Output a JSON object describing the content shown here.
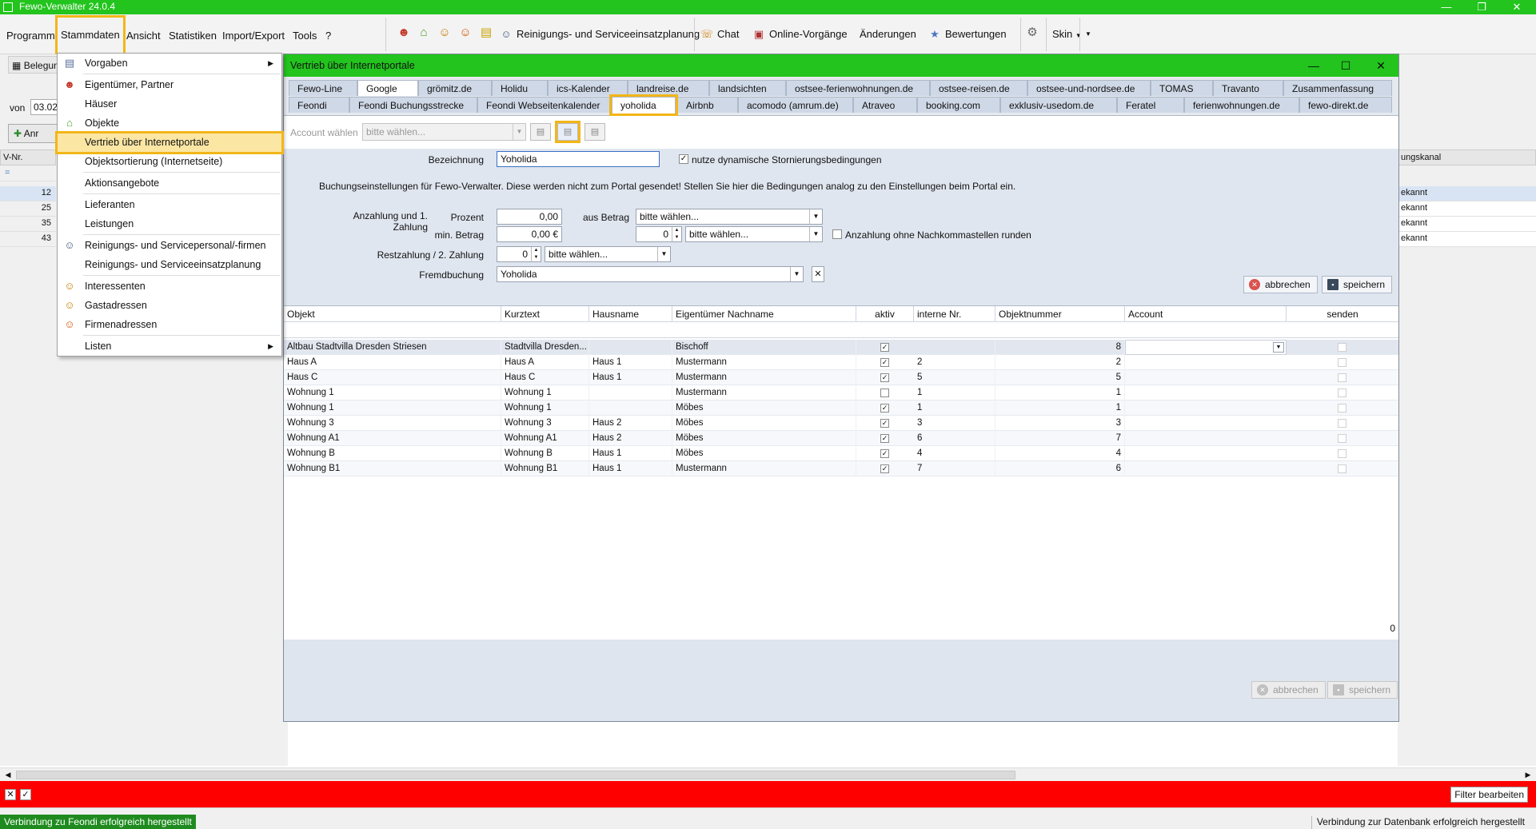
{
  "window": {
    "title": "Fewo-Verwalter 24.0.4"
  },
  "menubar": {
    "items": [
      "Programm",
      "Stammdaten",
      "Ansicht",
      "Statistiken",
      "Import/Export",
      "Tools",
      "?"
    ],
    "toolbar": {
      "cleaning_planning": "Reinigungs- und Serviceeinsatzplanung",
      "chat": "Chat",
      "online": "Online-Vorgänge",
      "changes": "Änderungen",
      "ratings": "Bewertungen",
      "skin": "Skin"
    }
  },
  "background": {
    "tab": "Belegung",
    "from_label": "von",
    "from_value": "03.02",
    "button": "Anr",
    "col_header": "V-Nr.",
    "filter_marker": "=",
    "rows": [
      "12",
      "25",
      "35",
      "43"
    ],
    "right_header": "ungskanal",
    "right_rows": [
      "ekannt",
      "ekannt",
      "ekannt",
      "ekannt"
    ]
  },
  "dropdown": {
    "items": [
      {
        "label": "Vorgaben",
        "icon": "settings-icon",
        "submenu": true
      },
      {
        "label": "Eigentümer, Partner",
        "icon": "people-icon",
        "submenu": false
      },
      {
        "label": "Häuser",
        "icon": "",
        "submenu": false
      },
      {
        "label": "Objekte",
        "icon": "house-icon",
        "submenu": false
      },
      {
        "label": "Vertrieb über Internetportale",
        "icon": "",
        "submenu": false
      },
      {
        "label": "Objektsortierung (Internetseite)",
        "icon": "",
        "submenu": false
      },
      {
        "label": "Aktionsangebote",
        "icon": "",
        "submenu": false
      },
      {
        "label": "Lieferanten",
        "icon": "",
        "submenu": false
      },
      {
        "label": "Leistungen",
        "icon": "",
        "submenu": false
      },
      {
        "label": "Reinigungs- und Servicepersonal/-firmen",
        "icon": "worker-icon",
        "submenu": false
      },
      {
        "label": "Reinigungs- und Serviceeinsatzplanung",
        "icon": "",
        "submenu": false
      },
      {
        "label": "Interessenten",
        "icon": "person-icon",
        "submenu": false
      },
      {
        "label": "Gastadressen",
        "icon": "person-icon",
        "submenu": false
      },
      {
        "label": "Firmenadressen",
        "icon": "person-icon",
        "submenu": false
      },
      {
        "label": "Listen",
        "icon": "",
        "submenu": true
      }
    ]
  },
  "dialog": {
    "title": "Vertrieb über Internetportale",
    "tabs_row1": [
      "Fewo-Line",
      "Google",
      "grömitz.de",
      "Holidu",
      "ics-Kalender",
      "landreise.de",
      "landsichten",
      "ostsee-ferienwohnungen.de",
      "ostsee-reisen.de",
      "ostsee-und-nordsee.de",
      "TOMAS",
      "Travanto",
      "Zusammenfassung"
    ],
    "tabs_row2": [
      "Feondi",
      "Feondi Buchungsstrecke",
      "Feondi Webseitenkalender",
      "yoholida",
      "Airbnb",
      "acomodo (amrum.de)",
      "Atraveo",
      "booking.com",
      "exklusiv-usedom.de",
      "Feratel",
      "ferienwohnungen.de",
      "fewo-direkt.de"
    ],
    "account_label": "Account wählen",
    "account_placeholder": "bitte wählen...",
    "form": {
      "bezeichnung_label": "Bezeichnung",
      "bezeichnung_value": "Yoholida",
      "dynamic_storno_label": "nutze dynamische Stornierungsbedingungen",
      "note": "Buchungseinstellungen für Fewo-Verwalter. Diese werden nicht zum Portal gesendet! Stellen Sie hier die Bedingungen analog zu den Einstellungen beim Portal ein.",
      "anzahlung_label": "Anzahlung und 1. Zahlung",
      "prozent_label": "Prozent",
      "prozent_value": "0,00",
      "aus_betrag_label": "aus Betrag",
      "aus_betrag_select": "bitte wählen...",
      "min_betrag_label": "min. Betrag",
      "min_betrag_value": "0,00 €",
      "min_days_value": "0",
      "min_select": "bitte wählen...",
      "round_label": "Anzahlung ohne Nachkommastellen runden",
      "restzahlung_label": "Restzahlung / 2. Zahlung",
      "rest_value": "0",
      "rest_select": "bitte wählen...",
      "fremdbuchung_label": "Fremdbuchung",
      "fremdbuchung_value": "Yoholida",
      "cancel": "abbrechen",
      "save": "speichern"
    },
    "grid": {
      "headers": [
        "Objekt",
        "Kurztext",
        "Hausname",
        "Eigentümer Nachname",
        "aktiv",
        "interne Nr.",
        "Objektnummer",
        "Account",
        "senden"
      ],
      "rows": [
        {
          "objekt": "Altbau Stadtvilla Dresden Striesen",
          "kurztext": "Stadtvilla Dresden...",
          "hausname": "",
          "eigentuemer": "Bischoff",
          "aktiv": true,
          "interne": "",
          "objektnummer": "8"
        },
        {
          "objekt": "Haus A",
          "kurztext": "Haus A",
          "hausname": "Haus 1",
          "eigentuemer": "Mustermann",
          "aktiv": true,
          "interne": "2",
          "objektnummer": "2"
        },
        {
          "objekt": "Haus C",
          "kurztext": "Haus C",
          "hausname": "Haus 1",
          "eigentuemer": "Mustermann",
          "aktiv": true,
          "interne": "5",
          "objektnummer": "5"
        },
        {
          "objekt": "Wohnung 1",
          "kurztext": "Wohnung 1",
          "hausname": "",
          "eigentuemer": "Mustermann",
          "aktiv": false,
          "interne": "1",
          "objektnummer": "1"
        },
        {
          "objekt": "Wohnung 1",
          "kurztext": "Wohnung 1",
          "hausname": "",
          "eigentuemer": "Möbes",
          "aktiv": true,
          "interne": "1",
          "objektnummer": "1"
        },
        {
          "objekt": "Wohnung 3",
          "kurztext": "Wohnung 3",
          "hausname": "Haus 2",
          "eigentuemer": "Möbes",
          "aktiv": true,
          "interne": "3",
          "objektnummer": "3"
        },
        {
          "objekt": "Wohnung A1",
          "kurztext": "Wohnung A1",
          "hausname": "Haus 2",
          "eigentuemer": "Möbes",
          "aktiv": true,
          "interne": "6",
          "objektnummer": "7"
        },
        {
          "objekt": "Wohnung B",
          "kurztext": "Wohnung B",
          "hausname": "Haus 1",
          "eigentuemer": "Möbes",
          "aktiv": true,
          "interne": "4",
          "objektnummer": "4"
        },
        {
          "objekt": "Wohnung B1",
          "kurztext": "Wohnung B1",
          "hausname": "Haus 1",
          "eigentuemer": "Mustermann",
          "aktiv": true,
          "interne": "7",
          "objektnummer": "6"
        }
      ],
      "footer_count": "0"
    },
    "bottom_cancel": "abbrechen",
    "bottom_save": "speichern"
  },
  "filterbar": {
    "edit_label": "Filter bearbeiten"
  },
  "status": {
    "left": "Verbindung zu Feondi erfolgreich hergestellt",
    "right": "Verbindung zur Datenbank erfolgreich hergestellt"
  },
  "colors": {
    "title_green": "#22c41d",
    "highlight": "#f2b618",
    "filter_red": "#ff0000",
    "status_green": "#1f8b1f"
  }
}
